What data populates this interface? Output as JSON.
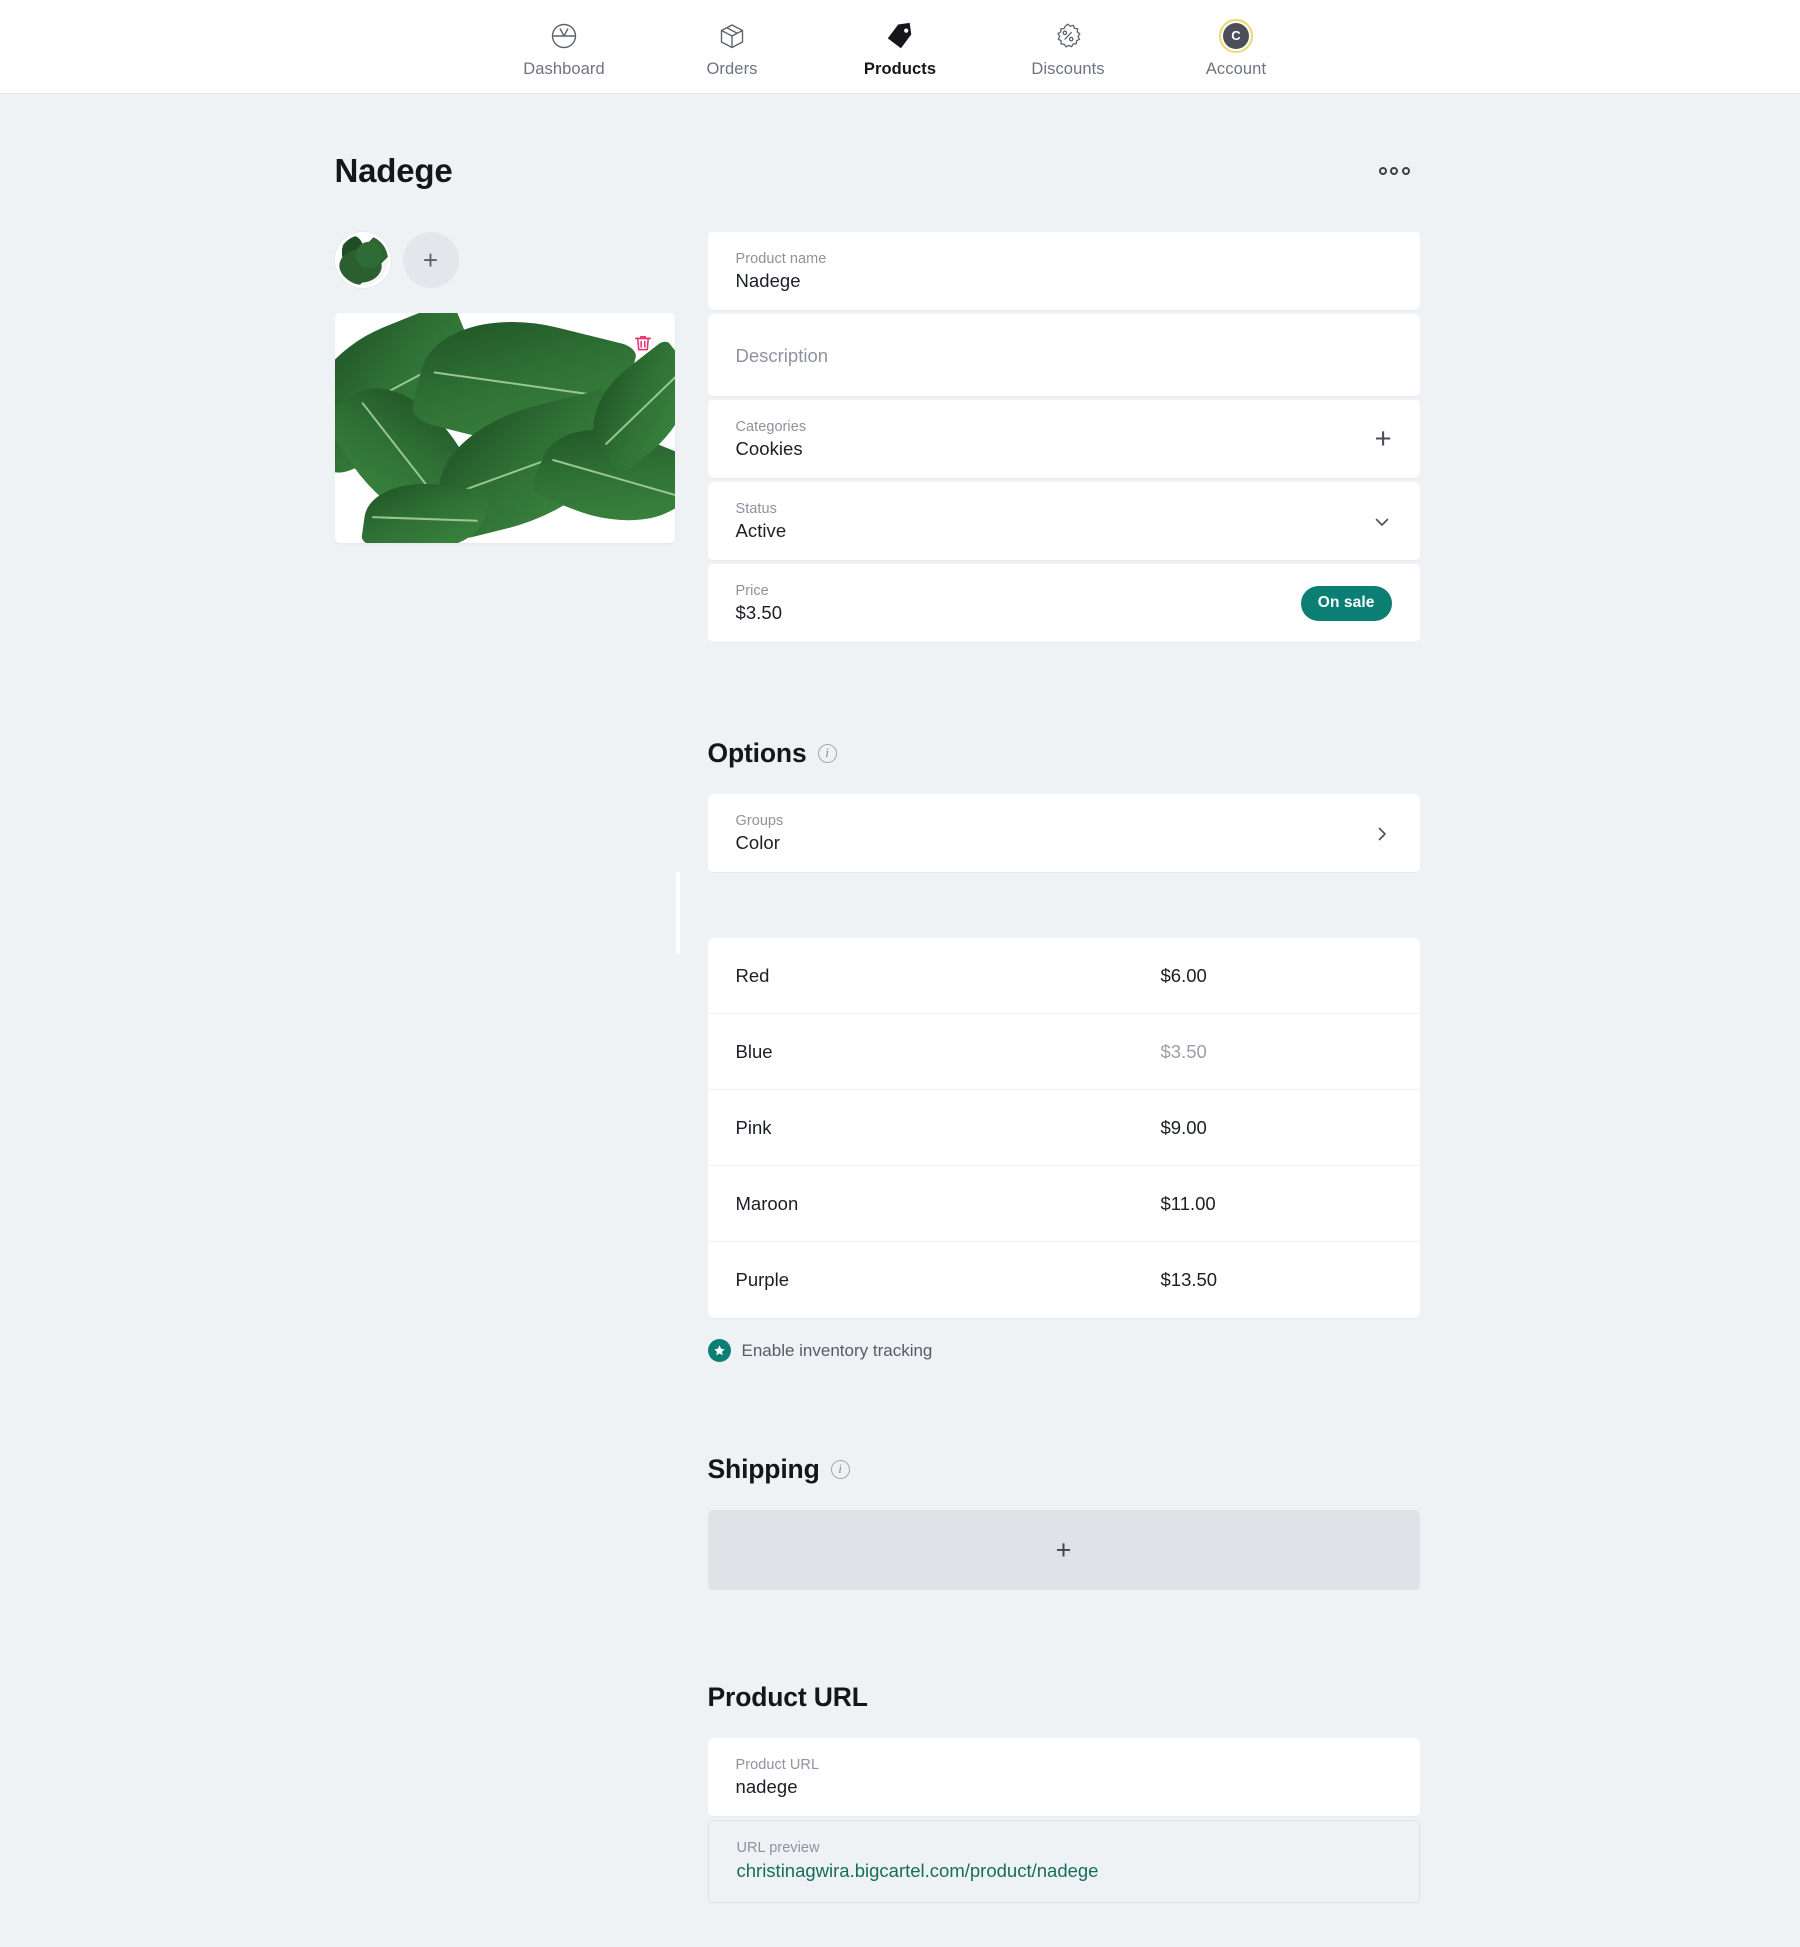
{
  "nav": {
    "items": [
      {
        "label": "Dashboard",
        "icon": "dashboard-gauge-icon",
        "active": false
      },
      {
        "label": "Orders",
        "icon": "box-icon",
        "active": false
      },
      {
        "label": "Products",
        "icon": "tag-icon",
        "active": true
      },
      {
        "label": "Discounts",
        "icon": "percent-badge-icon",
        "active": false
      },
      {
        "label": "Account",
        "icon": "avatar-icon",
        "active": false
      }
    ],
    "account_initial": "C"
  },
  "header": {
    "title": "Nadege",
    "overflow_menu": "more-options"
  },
  "media": {
    "thumbnail_alt": "product-thumbnail",
    "add_image_label": "+",
    "delete_label": "delete-image"
  },
  "details": {
    "product_name": {
      "label": "Product name",
      "value": "Nadege"
    },
    "description": {
      "label": "Description",
      "placeholder": "Description",
      "value": ""
    },
    "categories": {
      "label": "Categories",
      "value": "Cookies",
      "add_label": "+"
    },
    "status": {
      "label": "Status",
      "value": "Active",
      "options": [
        "Active"
      ]
    },
    "price": {
      "label": "Price",
      "value": "$3.50",
      "badge": "On sale"
    }
  },
  "options": {
    "title": "Options",
    "groups": {
      "label": "Groups",
      "value": "Color"
    },
    "variants": [
      {
        "name": "Red",
        "price": "$6.00",
        "muted": false
      },
      {
        "name": "Blue",
        "price": "$3.50",
        "muted": true
      },
      {
        "name": "Pink",
        "price": "$9.00",
        "muted": false
      },
      {
        "name": "Maroon",
        "price": "$11.00",
        "muted": false
      },
      {
        "name": "Purple",
        "price": "$13.50",
        "muted": false
      }
    ],
    "inventory_label": "Enable inventory tracking"
  },
  "shipping": {
    "title": "Shipping",
    "add_label": "+"
  },
  "product_url": {
    "title": "Product URL",
    "field": {
      "label": "Product URL",
      "value": "nadege"
    },
    "preview": {
      "label": "URL preview",
      "value": "christinagwira.bigcartel.com/product/nadege"
    }
  },
  "colors": {
    "accent_teal": "#0c7f75",
    "page_bg": "#eff2f5",
    "card_bg": "#ffffff",
    "link_green": "#156e5c",
    "trash_pink": "#e8336d",
    "ring_yellow": "#ecd96a"
  }
}
